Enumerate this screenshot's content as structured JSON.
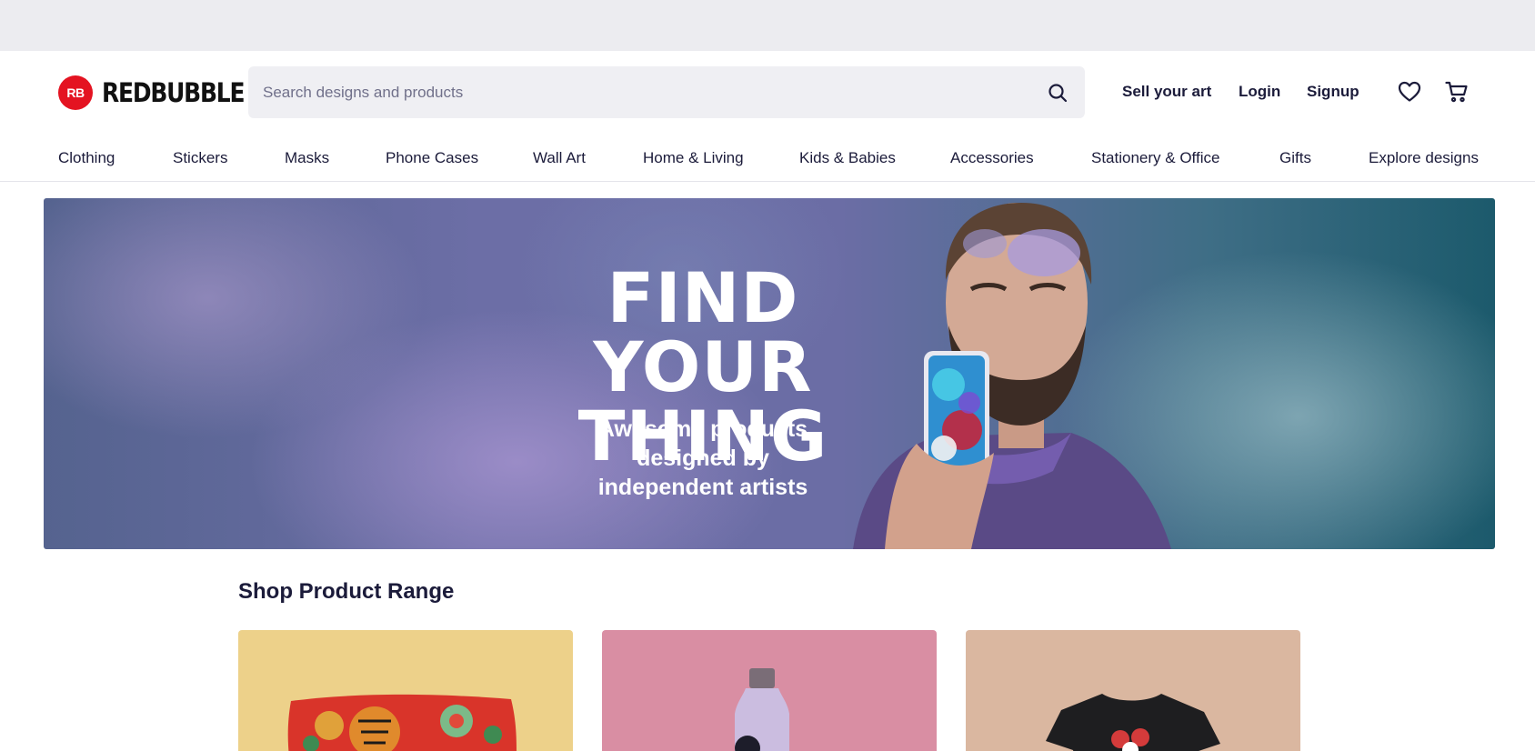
{
  "brand": {
    "name": "REDBUBBLE",
    "mark": "RB",
    "color": "#e41321"
  },
  "search": {
    "placeholder": "Search designs and products",
    "value": "",
    "icon": "search-icon"
  },
  "header_links": {
    "sell": "Sell your art",
    "login": "Login",
    "signup": "Signup"
  },
  "header_icons": {
    "wishlist": "heart-icon",
    "cart": "cart-icon"
  },
  "nav": {
    "items": [
      {
        "label": "Clothing"
      },
      {
        "label": "Stickers"
      },
      {
        "label": "Masks"
      },
      {
        "label": "Phone Cases"
      },
      {
        "label": "Wall Art"
      },
      {
        "label": "Home & Living"
      },
      {
        "label": "Kids & Babies"
      },
      {
        "label": "Accessories"
      },
      {
        "label": "Stationery & Office"
      },
      {
        "label": "Gifts"
      },
      {
        "label": "Explore designs"
      }
    ]
  },
  "hero": {
    "title_line1": "FIND YOUR",
    "title_line2": "THING",
    "subtitle_line1": "Awesome products designed by",
    "subtitle_line2": "independent artists"
  },
  "shop_range": {
    "title": "Shop Product Range",
    "cards": [
      {
        "product": "pillow",
        "bg": "#edd18a"
      },
      {
        "product": "water-bottle",
        "bg": "#d98ea3"
      },
      {
        "product": "t-shirt",
        "bg": "#dab7a0"
      }
    ]
  }
}
